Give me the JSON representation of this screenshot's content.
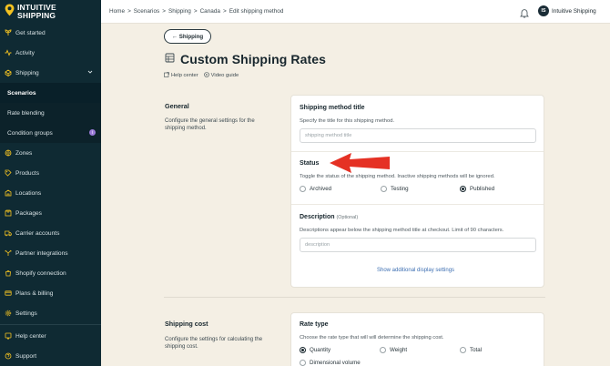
{
  "brand": {
    "line1": "INTUITIVE",
    "line2": "SHIPPING"
  },
  "sidebar": {
    "items": [
      {
        "label": "Get started",
        "icon": "sprout-icon"
      },
      {
        "label": "Activity",
        "icon": "activity-icon"
      },
      {
        "label": "Shipping",
        "icon": "shipping-icon"
      },
      {
        "label": "Scenarios"
      },
      {
        "label": "Rate blending"
      },
      {
        "label": "Condition groups"
      },
      {
        "label": "Zones",
        "icon": "zones-icon"
      },
      {
        "label": "Products",
        "icon": "products-icon"
      },
      {
        "label": "Locations",
        "icon": "locations-icon"
      },
      {
        "label": "Packages",
        "icon": "packages-icon"
      },
      {
        "label": "Carrier accounts",
        "icon": "truck-icon"
      },
      {
        "label": "Partner integrations",
        "icon": "integrations-icon"
      },
      {
        "label": "Shopify connection",
        "icon": "shopify-icon"
      },
      {
        "label": "Plans & billing",
        "icon": "billing-icon"
      },
      {
        "label": "Settings",
        "icon": "gear-icon"
      },
      {
        "label": "Help center",
        "icon": "help-icon"
      },
      {
        "label": "Support",
        "icon": "support-icon"
      }
    ],
    "condition_badge": "i"
  },
  "topbar": {
    "breadcrumbs": [
      "Home",
      ">",
      "Scenarios",
      ">",
      "Shipping",
      ">",
      "Canada",
      ">",
      "Edit shipping method"
    ],
    "user_initials": "IS",
    "user_name": "Intuitive Shipping"
  },
  "main": {
    "back_label": "← Shipping",
    "title": "Custom Shipping Rates",
    "help_center": "Help center",
    "video_guide": "Video guide",
    "general": {
      "title": "General",
      "desc": "Configure the general settings for the shipping method.",
      "method_title_label": "Shipping method title",
      "method_title_help": "Specify the title for this shipping method.",
      "method_title_placeholder": "shipping method title",
      "status_label": "Status",
      "status_help": "Toggle the status of the shipping method. Inactive shipping methods will be ignored.",
      "status_options": [
        "Archived",
        "Testing",
        "Published"
      ],
      "status_selected": "Published",
      "description_label": "Description",
      "description_optional": "(Optional)",
      "description_help": "Descriptions appear below the shipping method title at checkout. Limit of 90 characters.",
      "description_placeholder": "description",
      "show_more": "Show additional display settings"
    },
    "shipping_cost": {
      "title": "Shipping cost",
      "desc": "Configure the settings for calculating the shipping cost.",
      "rate_type_label": "Rate type",
      "rate_type_help": "Choose the rate type that will will determine the shipping cost.",
      "rate_options": [
        "Quantity",
        "Weight",
        "Total",
        "Dimensional volume"
      ],
      "rate_selected": "Quantity"
    }
  },
  "colors": {
    "sidebar": "#0f2a33",
    "background": "#f4efe4",
    "arrow": "#e53124",
    "link": "#3d6fb2"
  }
}
